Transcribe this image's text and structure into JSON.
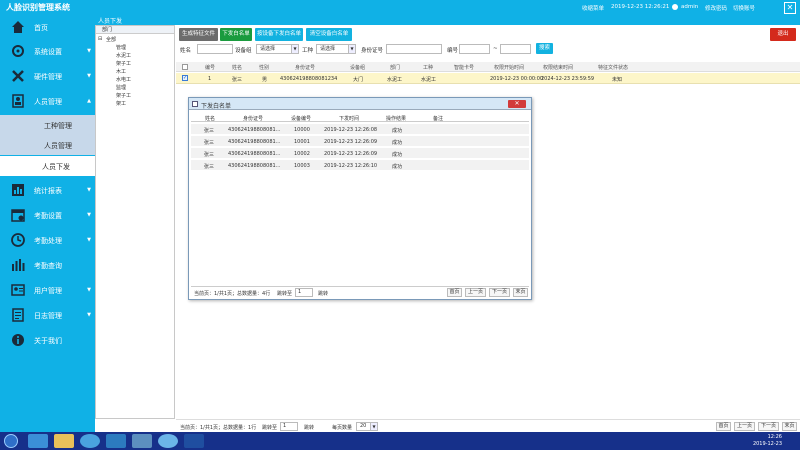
{
  "app": {
    "title": "人脸识别管理系统",
    "close": "✕"
  },
  "topbar": {
    "items": [
      "收缩菜单",
      "2019-12-23 12:26:21",
      "admin",
      "修改密码",
      "切换账号"
    ]
  },
  "breadcrumb": "人员下发",
  "sidebar": {
    "items": [
      {
        "label": "首页",
        "icon": "home-icon"
      },
      {
        "label": "系统设置",
        "icon": "gear-icon"
      },
      {
        "label": "硬件管理",
        "icon": "tools-icon"
      },
      {
        "label": "人员管理",
        "icon": "person-icon"
      },
      {
        "label": "统计报表",
        "icon": "chart-icon"
      },
      {
        "label": "考勤设置",
        "icon": "calendar-icon"
      },
      {
        "label": "考勤处理",
        "icon": "clock-icon"
      },
      {
        "label": "考勤查询",
        "icon": "bar-icon"
      },
      {
        "label": "用户管理",
        "icon": "user-icon"
      },
      {
        "label": "日志管理",
        "icon": "log-icon"
      },
      {
        "label": "关于我们",
        "icon": "info-icon"
      }
    ],
    "subitems": [
      "工种管理",
      "人员管理",
      "人员下发"
    ]
  },
  "tree": {
    "header": "部门",
    "nodes": [
      "全部",
      "管理",
      "水泥工",
      "架子工",
      "木工",
      "水电工",
      "监理",
      "架子工",
      "架工"
    ]
  },
  "toolbar": {
    "buttons": [
      "生成特征文件",
      "下发白名单",
      "按设备下发白名单",
      "清空设备白名单"
    ],
    "exit": "退出",
    "search": "搜索"
  },
  "filters": {
    "name_label": "姓名",
    "device_group_label": "设备组",
    "device_group_value": "请选择",
    "worktype_label": "工种",
    "worktype_value": "请选择",
    "idcard_label": "身份证号",
    "number_label": "编号",
    "range_sep": "~"
  },
  "grid": {
    "columns": [
      "编号",
      "姓名",
      "性别",
      "身份证号",
      "设备组",
      "部门",
      "工种",
      "智能卡号",
      "权限开始时间",
      "权限结束时间",
      "特征文件状态"
    ],
    "rows": [
      {
        "no": "1",
        "name": "张三",
        "gender": "男",
        "idcard": "430624198808081234",
        "devgroup": "大门",
        "dept": "水泥工",
        "worktype": "水泥工",
        "card": "",
        "start": "2019-12-23 00:00:00",
        "end": "2024-12-23 23:59:59",
        "status": "未知"
      }
    ]
  },
  "pager": {
    "info": "当前页：1/共1页；总数据量：1行",
    "jump_label": "跳转至",
    "page_value": "1",
    "jump": "跳转",
    "pagesize_label": "每页数量",
    "pagesize_value": "20",
    "first": "首页",
    "prev": "上一页",
    "next": "下一页",
    "last": "末页"
  },
  "modal": {
    "title": "下发白名单",
    "columns": [
      "姓名",
      "身份证号",
      "设备编号",
      "下发时间",
      "操作结果",
      "备注"
    ],
    "rows": [
      {
        "name": "张三",
        "idcard": "430624198808081...",
        "device": "10000",
        "time": "2019-12-23 12:26:08",
        "result": "成功"
      },
      {
        "name": "张三",
        "idcard": "430624198808081...",
        "device": "10001",
        "time": "2019-12-23 12:26:09",
        "result": "成功"
      },
      {
        "name": "张三",
        "idcard": "430624198808081...",
        "device": "10002",
        "time": "2019-12-23 12:26:09",
        "result": "成功"
      },
      {
        "name": "张三",
        "idcard": "430624198808081...",
        "device": "10003",
        "time": "2019-12-23 12:26:10",
        "result": "成功"
      }
    ],
    "pager": {
      "info": "当前页：1/共1页；总数据量：4行",
      "jump_label": "跳转至",
      "page_value": "1",
      "jump": "跳转",
      "first": "首页",
      "prev": "上一页",
      "next": "下一页",
      "last": "末页"
    }
  },
  "taskbar": {
    "time": "12:26",
    "date": "2019-12-23"
  },
  "colors": {
    "primary": "#10b1e6",
    "submenu": "#c7d8ea",
    "row_selected": "#fdf6c9",
    "exit": "#d42a1c"
  }
}
